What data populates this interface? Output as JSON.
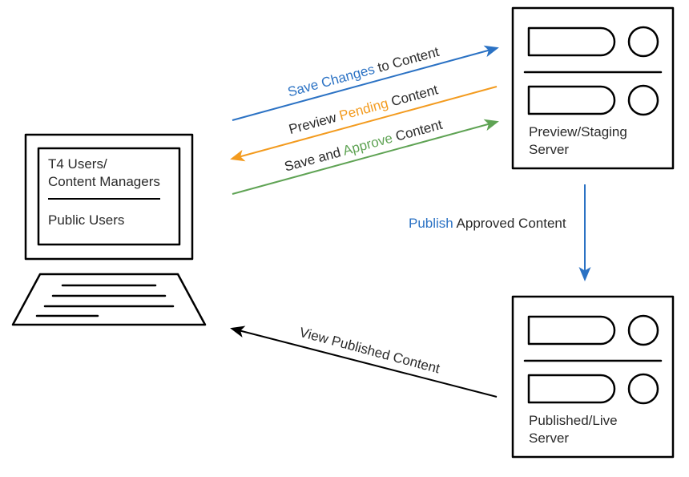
{
  "computer": {
    "line1": "T4 Users/",
    "line2": "Content Managers",
    "line3": "Public Users"
  },
  "servers": {
    "preview": {
      "line1": "Preview/Staging",
      "line2": "Server"
    },
    "live": {
      "line1": "Published/Live",
      "line2": "Server"
    }
  },
  "arrows": {
    "save": {
      "pre": "",
      "hl": "Save Changes",
      "post": " to Content",
      "color": "#2b72c4"
    },
    "preview": {
      "pre": "Preview ",
      "hl": "Pending",
      "post": " Content",
      "color": "#f39b1f"
    },
    "approve": {
      "pre": "Save and ",
      "hl": "Approve",
      "post": " Content",
      "color": "#5fa354"
    },
    "publish": {
      "pre": "",
      "hl": "Publish",
      "post": " Approved Content",
      "color": "#2b72c4"
    },
    "view": {
      "pre": "",
      "hl": "",
      "post": "View Published Content",
      "color": "#000000"
    }
  }
}
